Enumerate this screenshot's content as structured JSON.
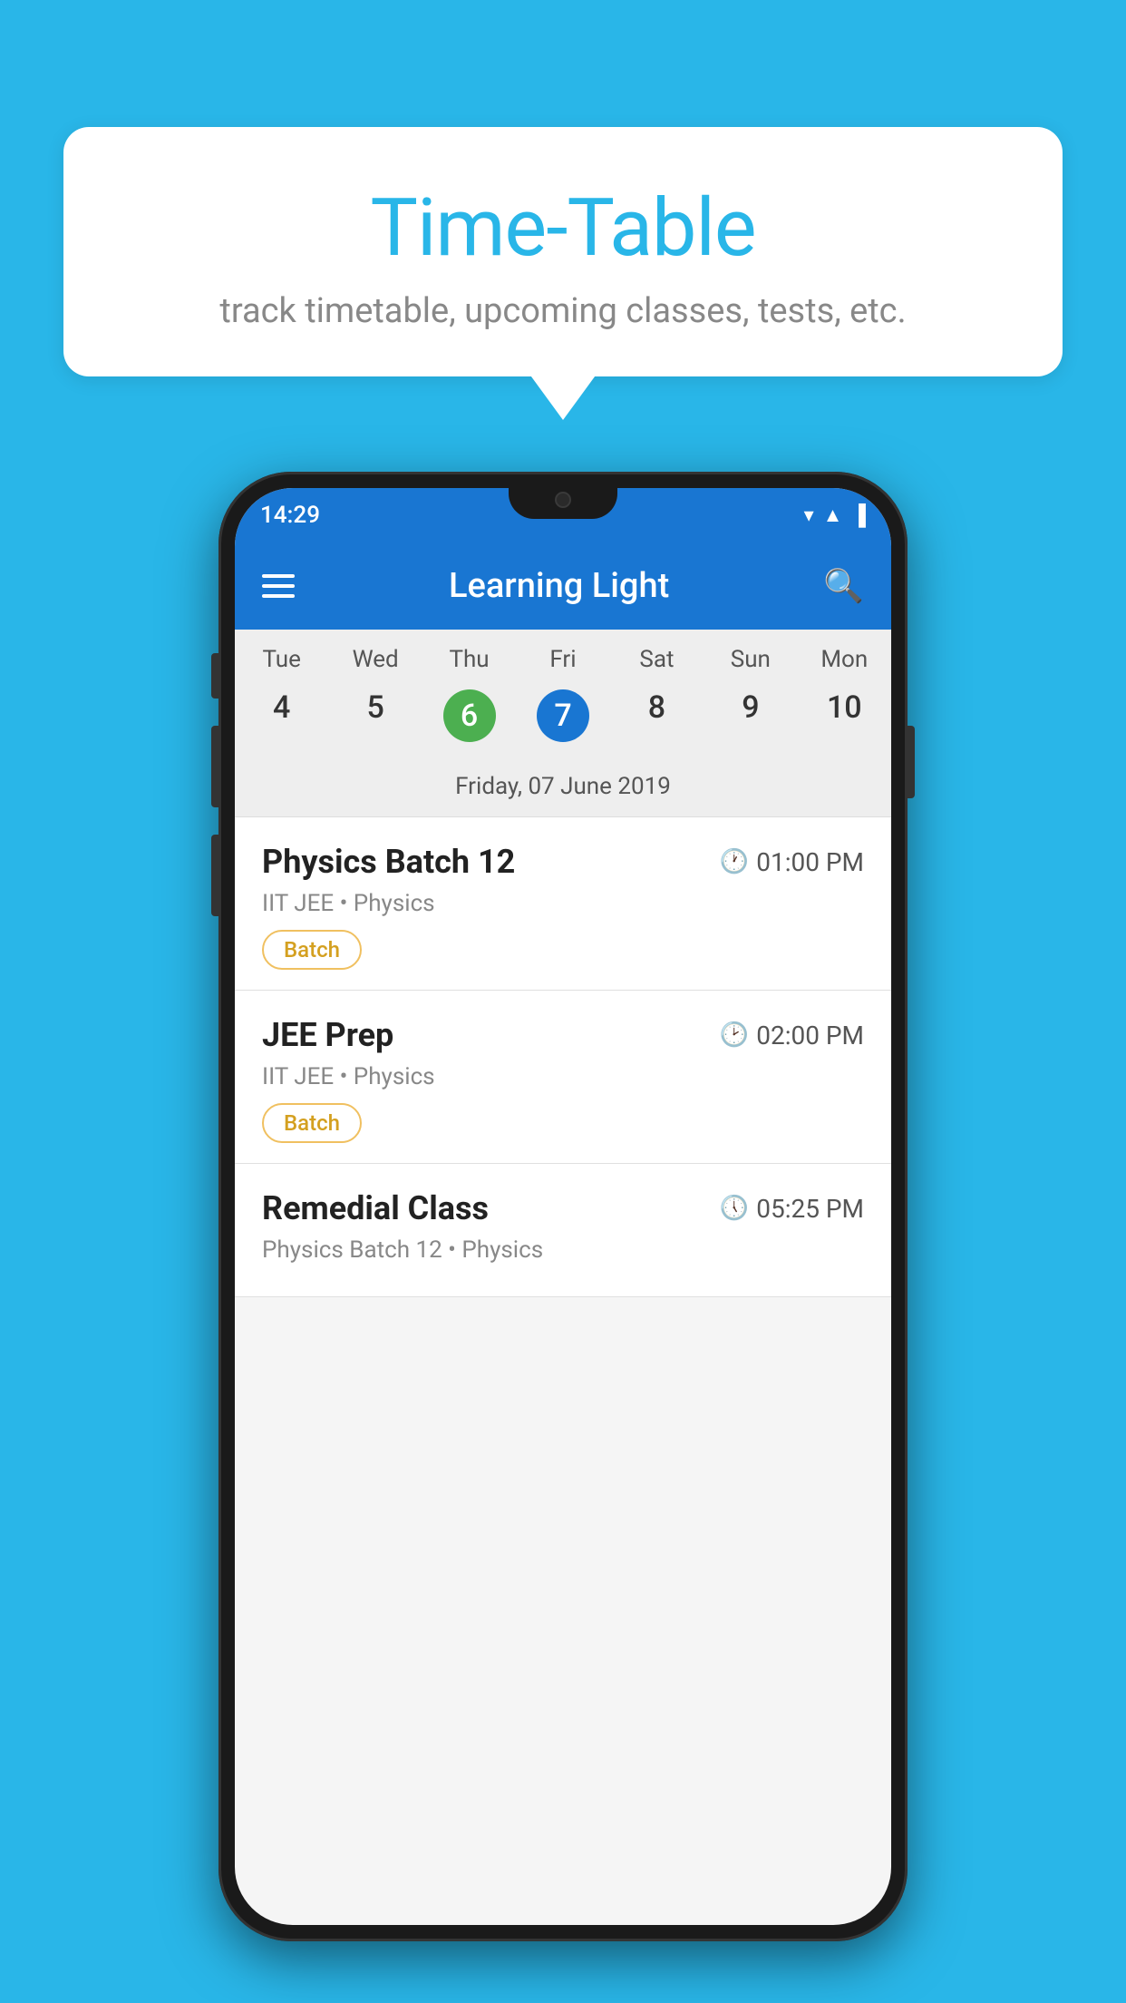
{
  "background_color": "#29b6e8",
  "bubble": {
    "title": "Time-Table",
    "subtitle": "track timetable, upcoming classes, tests, etc."
  },
  "status_bar": {
    "time": "14:29"
  },
  "app_bar": {
    "title": "Learning Light"
  },
  "calendar": {
    "days_of_week": [
      "Tue",
      "Wed",
      "Thu",
      "Fri",
      "Sat",
      "Sun",
      "Mon"
    ],
    "dates": [
      "4",
      "5",
      "6",
      "7",
      "8",
      "9",
      "10"
    ],
    "today_index": 2,
    "selected_index": 3,
    "selected_label": "Friday, 07 June 2019"
  },
  "schedule": [
    {
      "title": "Physics Batch 12",
      "time": "01:00 PM",
      "subtitle": "IIT JEE • Physics",
      "badge": "Batch"
    },
    {
      "title": "JEE Prep",
      "time": "02:00 PM",
      "subtitle": "IIT JEE • Physics",
      "badge": "Batch"
    },
    {
      "title": "Remedial Class",
      "time": "05:25 PM",
      "subtitle": "Physics Batch 12 • Physics",
      "badge": ""
    }
  ]
}
